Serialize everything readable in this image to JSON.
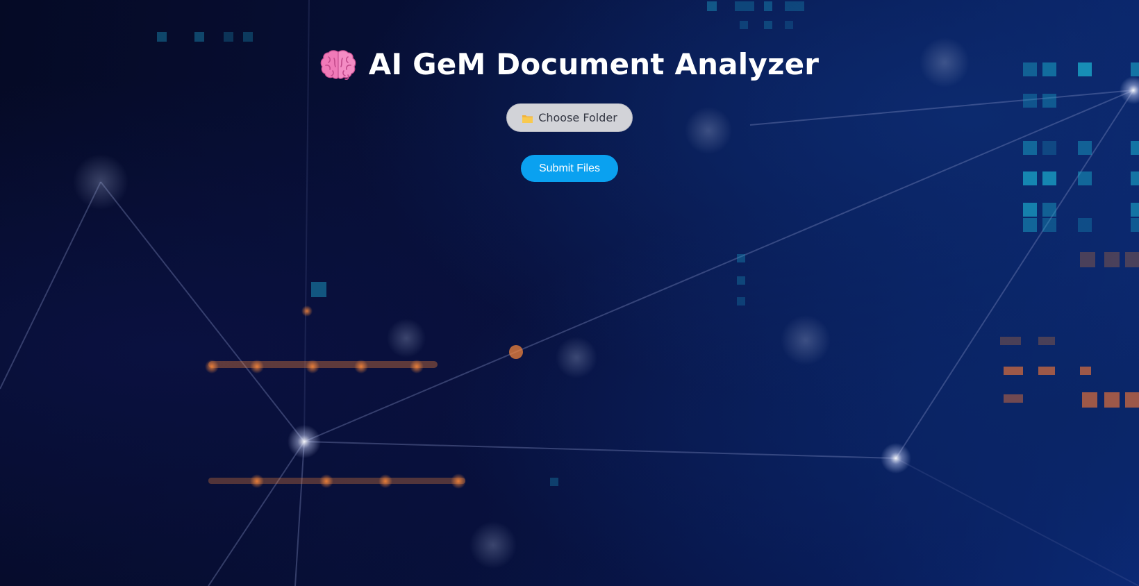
{
  "header": {
    "title": "AI GeM Document Analyzer",
    "icon": "brain-icon"
  },
  "upload": {
    "choose_folder_label": "Choose Folder",
    "choose_folder_icon": "folder-icon",
    "submit_label": "Submit Files"
  },
  "colors": {
    "background": "#07103a",
    "choose_folder_bg": "#d2d3d8",
    "submit_bg": "#0aa1f0",
    "title_text": "#ffffff"
  }
}
